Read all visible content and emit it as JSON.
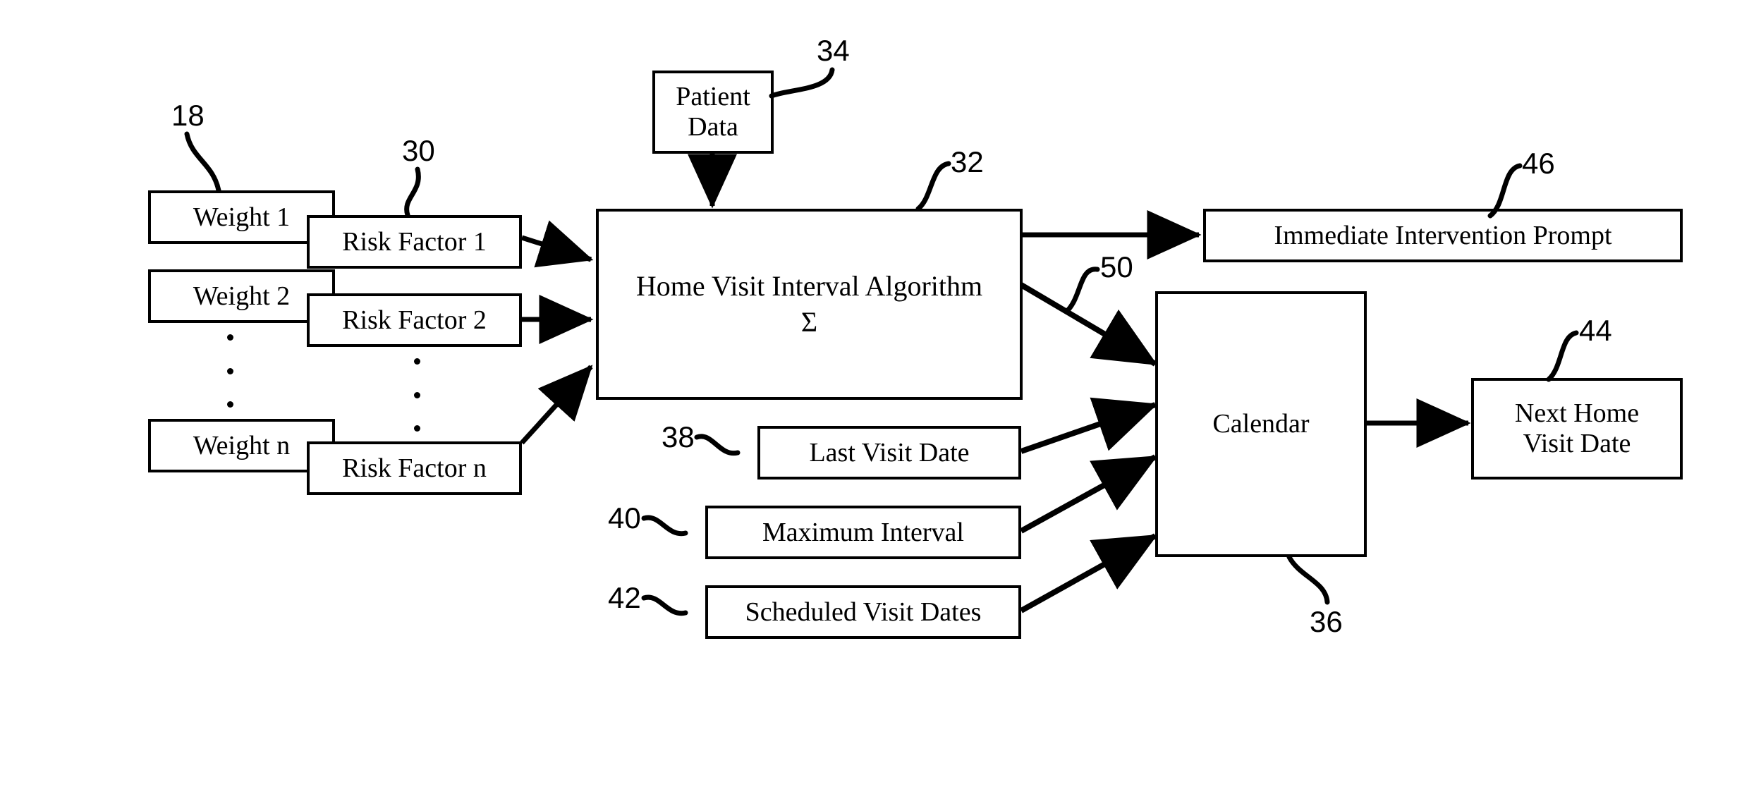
{
  "figure": {
    "kind": "patent-block-diagram",
    "background_color": "#ffffff",
    "line_color": "#000000"
  },
  "weights": [
    {
      "label": "Weight 1"
    },
    {
      "label": "Weight 2"
    },
    {
      "label": "Weight n"
    }
  ],
  "risk_factors": [
    {
      "label": "Risk Factor 1"
    },
    {
      "label": "Risk Factor 2"
    },
    {
      "label": "Risk Factor n"
    }
  ],
  "nodes": {
    "patient_data": {
      "label": "Patient\nData"
    },
    "algorithm": {
      "title": "Home Visit Interval Algorithm",
      "operator": "Σ"
    },
    "last_visit_date": {
      "label": "Last Visit Date"
    },
    "maximum_interval": {
      "label": "Maximum Interval"
    },
    "scheduled_visit_dates": {
      "label": "Scheduled Visit Dates"
    },
    "calendar": {
      "label": "Calendar"
    },
    "immediate_intervention_prompt": {
      "label": "Immediate Intervention Prompt"
    },
    "next_home_visit_date": {
      "label": "Next Home\nVisit Date"
    }
  },
  "reference_numerals": {
    "weights_group": "18",
    "risk_factors_group": "30",
    "patient_data": "34",
    "algorithm": "32",
    "last_visit_date": "38",
    "maximum_interval": "40",
    "scheduled_visit_dates": "42",
    "calendar": "36",
    "algorithm_to_calendar": "50",
    "immediate_intervention_prompt": "46",
    "next_home_visit_date": "44"
  }
}
